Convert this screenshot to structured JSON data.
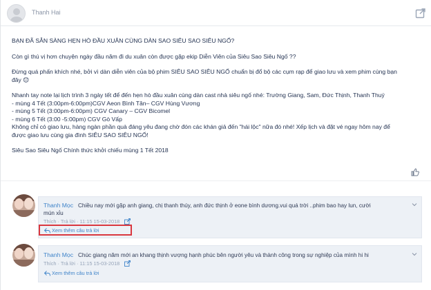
{
  "post": {
    "author": "Thanh Hai",
    "lines": [
      "BẠN ĐÃ SẴN SÀNG HẸN HÒ ĐẦU XUÂN CÙNG DÀN SAO SIÊU SAO SIÊU NGỐ?",
      "",
      "Còn gì thú vị hơn chuyện ngày đầu năm đi du xuân còn được gặp ekip Diễn Viên của Siêu Sao Siêu Ngố ??",
      "",
      "Đừng quá phấn khích nhé, bởi vì dàn diễn viên của bộ phim SIÊU SAO SIÊU NGỐ chuẩn bị đổ bộ các cụm rạp để giao lưu và xem phim cùng bạn",
      "đây 😊",
      "",
      "Nhanh tay note lại lịch trình 3 ngày tết để đến hẹn hò đầu xuân cùng dàn cast nhà siêu ngố nhé: Trường Giang, Sam, Đức Thịnh, Thanh Thuý",
      "- mùng 4 Tết (3:00pm-6:00pm)CGV Aeon Bình Tân– CGV Hùng Vương",
      "- mùng 5 Tết (3:00pm-6:00pm) CGV Canary  – CGV Bicomel",
      "- mùng 6 Tết (3:00 -5:00pm) CGV Gò Vấp",
      "Không chỉ có giao lưu, hàng ngàn phần quà đáng yêu đang chờ đón các khán giả đến \"hái lộc\" nữa đó nhé! Xếp lịch và đặt vé ngay hôm nay để",
      "được giao lưu cùng gia đình SIÊU SAO SIÊU NGỐ!",
      "",
      "Siêu Sao Siêu Ngố   Chính thức khởi chiếu mùng 1 Tết 2018"
    ]
  },
  "comments": [
    {
      "name": "Thanh Mọc",
      "text1": "Chiều nay mới gặp anh giang, chị thanh thúy, anh đức thịnh ở eone bình dương.vui quá trời ..phim bao hay lun, cười",
      "text2": "mún xỉu",
      "time": "Thích · Trả lời · 11:15 15-03-2018",
      "reply": "Xem thêm câu trả lời"
    },
    {
      "name": "Thanh Mọc",
      "text1": "Chúc giang năm mới an khang thịnh vượng hạnh phúc bên người yêu và thành công trong sự nghiệp của mình hi hi",
      "text2": "",
      "time": "Thích · Trả lời · 11:15 15-03-2018",
      "reply": "Xem thêm câu trả lời"
    }
  ],
  "colors": {
    "accent": "#3e83c9",
    "highlight": "#d9363e",
    "comment_bg": "#edf1f6"
  }
}
